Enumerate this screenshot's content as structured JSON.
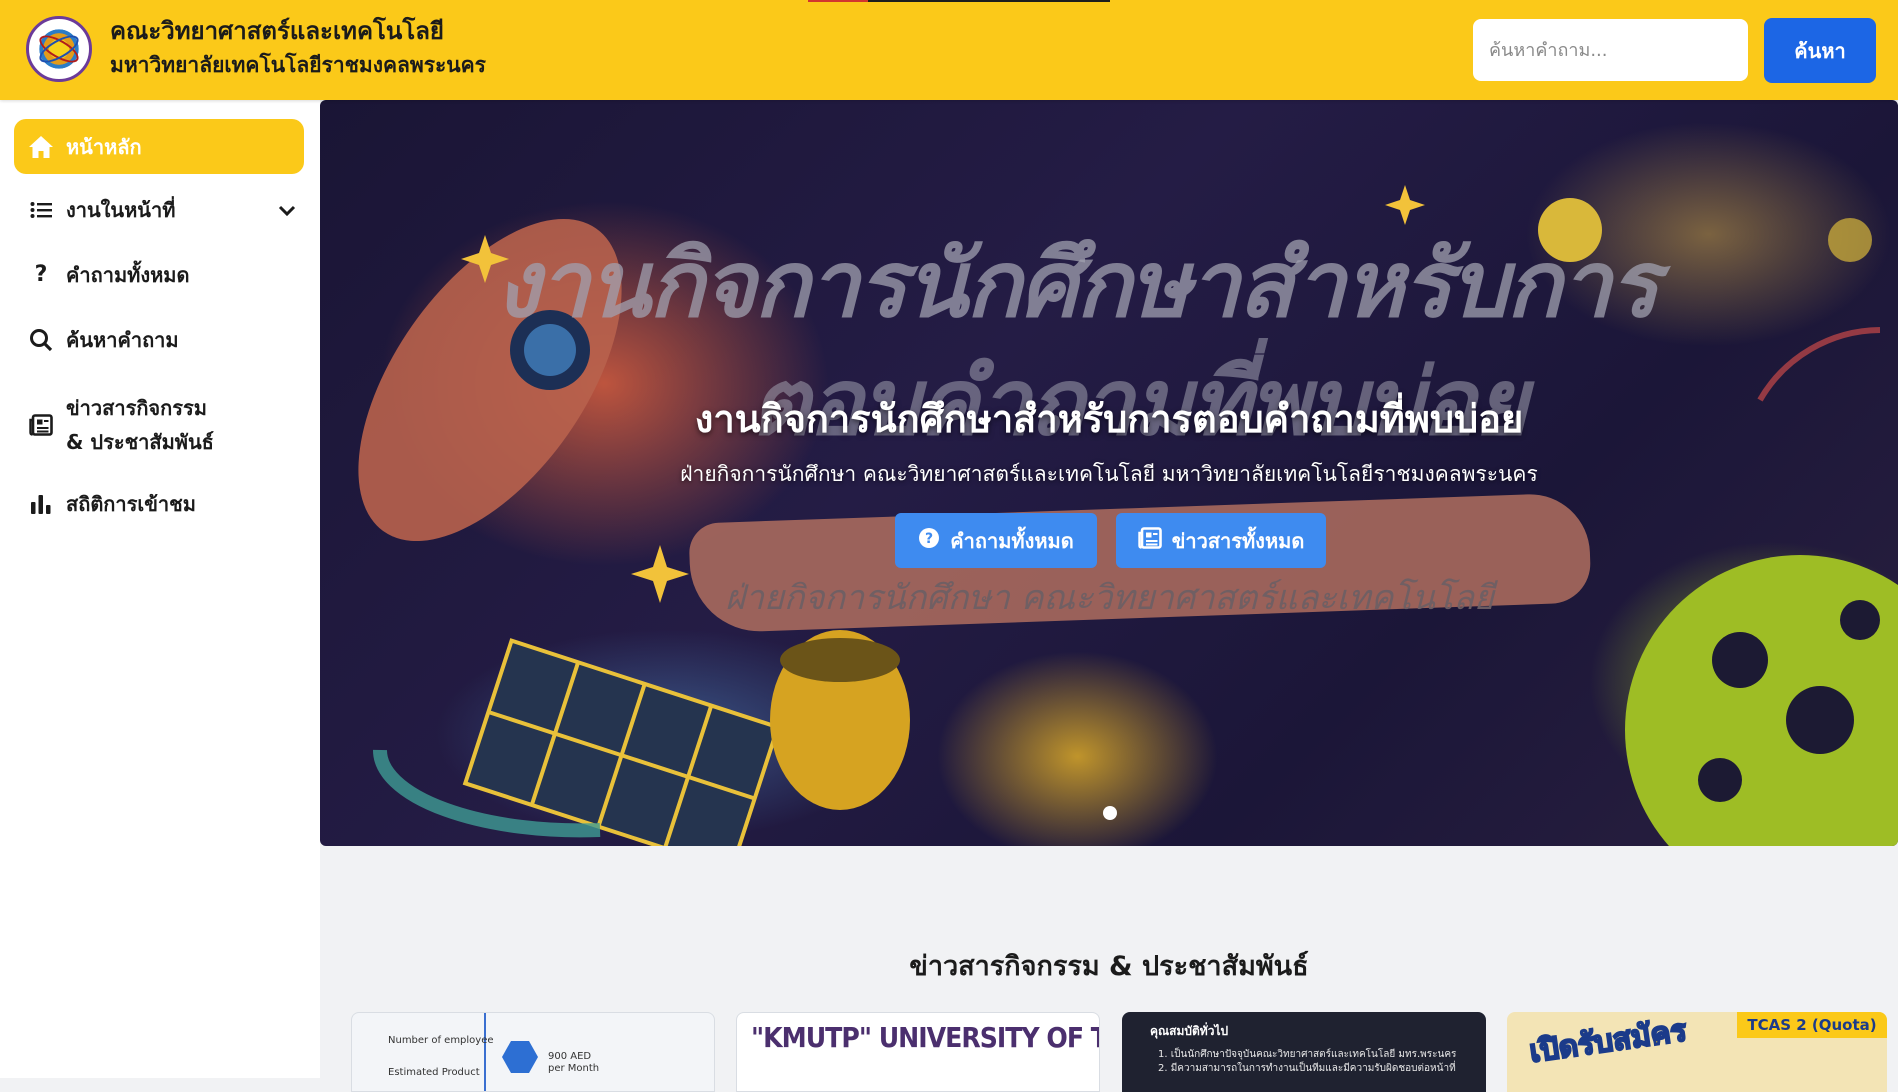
{
  "header": {
    "title_line1": "คณะวิทยาศาสตร์และเทคโนโลยี",
    "title_line2": "มหาวิทยาลัยเทคโนโลยีราชมงคลพระนคร",
    "search_placeholder": "ค้นหาคำถาม...",
    "search_button": "ค้นหา"
  },
  "sidebar": {
    "items": [
      {
        "label": "หน้าหลัก",
        "icon": "home-icon",
        "active": true
      },
      {
        "label": "งานในหน้าที่",
        "icon": "list-icon",
        "has_dropdown": true
      },
      {
        "label": "คำถามทั้งหมด",
        "icon": "question-icon"
      },
      {
        "label": "ค้นหาคำถาม",
        "icon": "search-icon"
      },
      {
        "label_line1": "ข่าวสารกิจกรรม",
        "label_line2": "& ประชาสัมพันธ์",
        "icon": "newspaper-icon"
      },
      {
        "label": "สถิติการเข้าชม",
        "icon": "bar-chart-icon"
      }
    ]
  },
  "hero": {
    "ghost_title_1": "งานกิจการนักศึกษาสำหรับการ",
    "ghost_title_2": "ตอบคำถามที่พบบ่อย",
    "ghost_subtitle": "ฝ่ายกิจการนักศึกษา คณะวิทยาศาสตร์และเทคโนโลยี",
    "title": "งานกิจการนักศึกษาสำหรับการตอบคำถามที่พบบ่อย",
    "subtitle": "ฝ่ายกิจการนักศึกษา คณะวิทยาศาสตร์และเทคโนโลยี มหาวิทยาลัยเทคโนโลยีราชมงคลพระนคร",
    "btn_all_questions": "คำถามทั้งหมด",
    "btn_all_news": "ข่าวสารทั้งหมด",
    "carousel_slides": 1,
    "carousel_active": 1
  },
  "news": {
    "section_title": "ข่าวสารกิจกรรม & ประชาสัมพันธ์",
    "card1": {
      "cap1": "Number of employee",
      "cap2": "Estimated Product",
      "cap3": "900 AED",
      "cap4": "per Month"
    },
    "card2": {
      "text": "\"KMUTP\" UNIVERSITY OF TECHNOLOGY"
    },
    "card3": {
      "title": "คุณสมบัติทั่วไป",
      "line1": "1. เป็นนักศึกษาปัจจุบันคณะวิทยาศาสตร์และเทคโนโลยี มทร.พระนคร",
      "line2": "2. มีความสามารถในการทำงานเป็นทีมและมีความรับผิดชอบต่อหน้าที่"
    },
    "card4": {
      "open": "เปิดรับสมัคร",
      "tcas": "TCAS 2 (Quota)"
    }
  },
  "colors": {
    "brand_yellow": "#fbc919",
    "primary_blue": "#1c66e5",
    "hero_button_blue": "#3e8bf0"
  }
}
